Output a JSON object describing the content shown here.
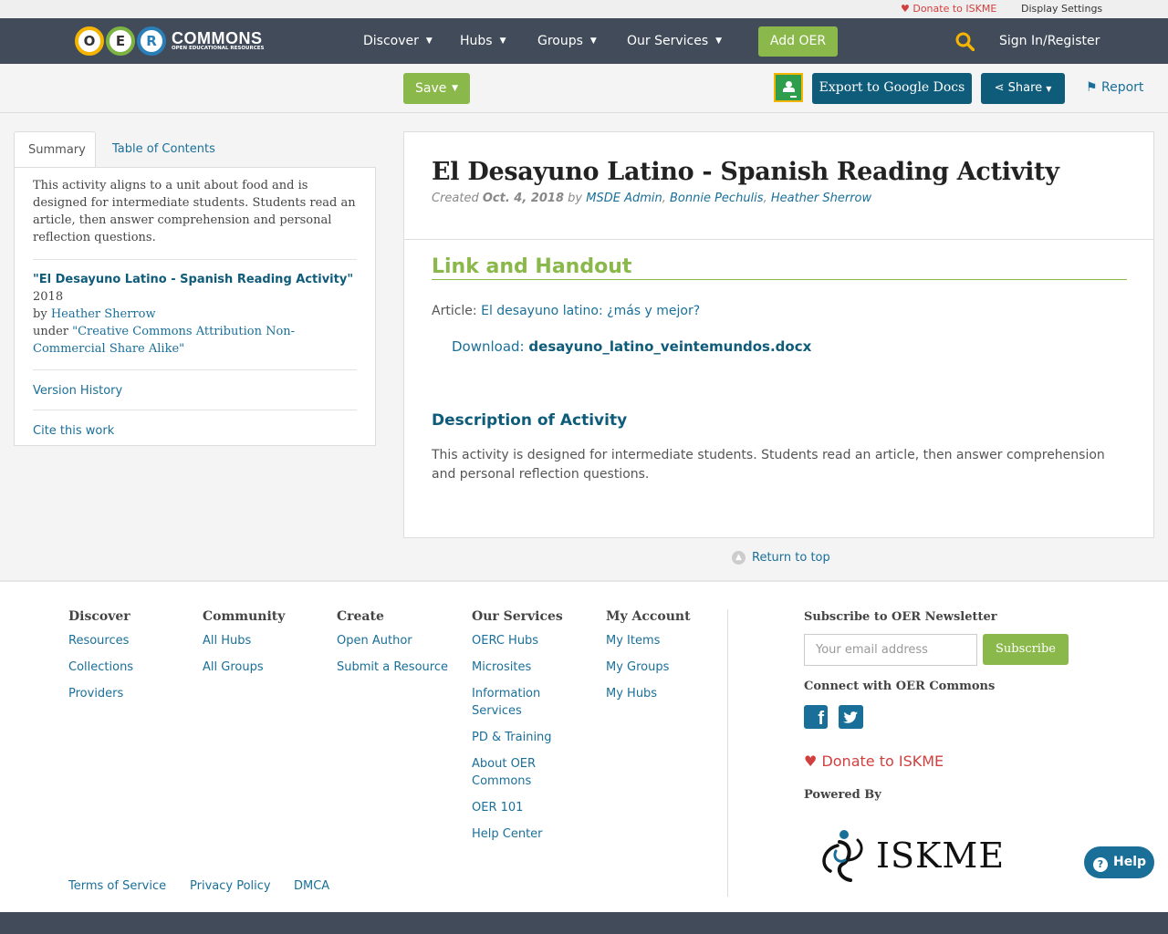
{
  "topbar": {
    "donate": "♥ Donate to ISKME",
    "display_settings": "Display Settings"
  },
  "nav": {
    "logo_letters": [
      "O",
      "E",
      "R"
    ],
    "logo_word": "COMMONS",
    "logo_tagline": "OPEN EDUCATIONAL RESOURCES",
    "items": [
      "Discover",
      "Hubs",
      "Groups",
      "Our Services"
    ],
    "add_oer": "Add OER",
    "signin": "Sign In/Register"
  },
  "toolbar": {
    "save": "Save",
    "export": "Export to Google Docs",
    "share": "Share",
    "report": "Report"
  },
  "sidebar": {
    "tab_summary": "Summary",
    "tab_toc": "Table of Contents",
    "description": "This activity aligns to a unit about food and is designed for intermediate students. Students read an article, then answer comprehension and personal reflection questions.",
    "attr_title": "\"El Desayuno Latino - Spanish Reading Activity\"",
    "attr_year": "2018",
    "attr_by": "by",
    "attr_author": "Heather Sherrow",
    "attr_under": "under",
    "attr_license": "\"Creative Commons Attribution Non-Commercial Share Alike\"",
    "version_history": "Version History",
    "cite": "Cite this work"
  },
  "main": {
    "title": "El Desayuno Latino - Spanish Reading Activity",
    "created_label": "Created",
    "created_date": "Oct. 4, 2018",
    "by": "by",
    "authors": [
      "MSDE Admin",
      "Bonnie Pechulis",
      "Heather Sherrow"
    ],
    "section1": "Link and Handout",
    "article_label": "Article:",
    "article_link": "El desayuno latino: ¿más y mejor?",
    "download_label": "Download:",
    "download_file": "desayuno_latino_veintemundos.docx",
    "section2": "Description of Activity",
    "description": "This activity is designed for intermediate students. Students read an article, then answer comprehension and personal reflection questions.",
    "return_top": "Return to top"
  },
  "footer": {
    "discover": {
      "heading": "Discover",
      "links": [
        "Resources",
        "Collections",
        "Providers"
      ]
    },
    "community": {
      "heading": "Community",
      "links": [
        "All Hubs",
        "All Groups"
      ]
    },
    "create": {
      "heading": "Create",
      "links": [
        "Open Author",
        "Submit a Resource"
      ]
    },
    "services": {
      "heading": "Our Services",
      "links": [
        "OERC Hubs",
        "Microsites",
        "Information Services",
        "PD & Training",
        "About OER Commons",
        "OER 101",
        "Help Center"
      ]
    },
    "account": {
      "heading": "My Account",
      "links": [
        "My Items",
        "My Groups",
        "My Hubs"
      ]
    },
    "newsletter_heading": "Subscribe to OER Newsletter",
    "email_placeholder": "Your email address",
    "subscribe": "Subscribe",
    "connect_heading": "Connect with OER Commons",
    "donate": "Donate to ISKME",
    "powered_by": "Powered By",
    "iskme_logo": "ISKME",
    "legal": [
      "Terms of Service",
      "Privacy Policy",
      "DMCA"
    ],
    "help": "Help"
  },
  "colors": {
    "navbar": "#414b5a",
    "green": "#8bb84a",
    "teal": "#0f5b7a",
    "link": "#1a6f99",
    "donate": "#d13f3f"
  }
}
